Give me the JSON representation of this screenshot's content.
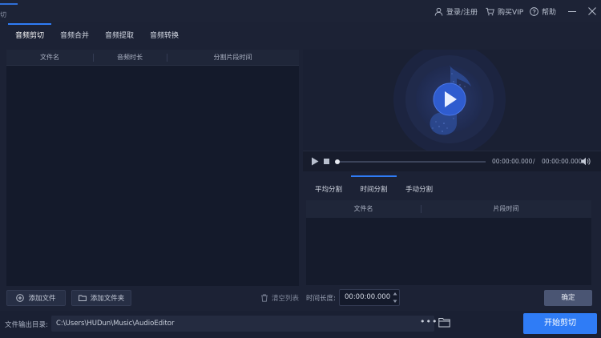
{
  "window": {
    "title": "切",
    "title_suffix": ""
  },
  "header": {
    "login_label": "登录/注册",
    "vip_label": "购买VIP",
    "help_label": "帮助",
    "accent": "#2f7cf6"
  },
  "tabs": [
    {
      "label": "音频剪切",
      "active": true
    },
    {
      "label": "音频合并",
      "active": false
    },
    {
      "label": "音频提取",
      "active": false
    },
    {
      "label": "音频转换",
      "active": false
    }
  ],
  "file_table": {
    "columns": [
      "文件名",
      "音频时长",
      "分割片段时间"
    ],
    "rows": []
  },
  "left_actions": {
    "add_file": "添加文件",
    "add_folder": "添加文件夹",
    "clear_list": "清空列表"
  },
  "player": {
    "current_time": "00:00:00.000",
    "separator": "/",
    "total_time": "00:00:00.000",
    "progress": 0.0
  },
  "split_tabs": [
    {
      "label": "平均分割",
      "active": false
    },
    {
      "label": "时间分割",
      "active": true
    },
    {
      "label": "手动分割",
      "active": false
    }
  ],
  "segment_table": {
    "columns": [
      "文件名",
      "片段时间"
    ],
    "rows": []
  },
  "time_length": {
    "label": "时间长度:",
    "value": "00:00:00.000"
  },
  "confirm_label": "确定",
  "output": {
    "label": "文件输出目录:",
    "path": "C:\\Users\\HUDun\\Music\\AudioEditor",
    "more": "•••"
  },
  "start_label": "开始剪切"
}
